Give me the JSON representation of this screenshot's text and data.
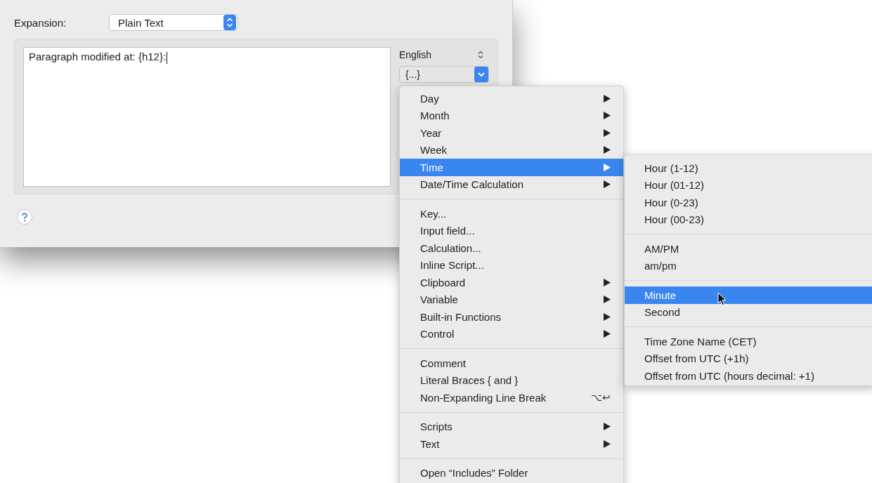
{
  "dialog": {
    "expansion_label": "Expansion:",
    "expansion_popup": {
      "value": "Plain Text"
    },
    "text_area": {
      "value": "Paragraph modified at: {h12}:"
    },
    "language_popup": {
      "value": "English"
    },
    "placeholder_popup": {
      "value": "{...}",
      "open": true
    }
  },
  "menu": {
    "groups": [
      {
        "items": [
          {
            "label": "Day",
            "submenu": true,
            "selected": false
          },
          {
            "label": "Month",
            "submenu": true,
            "selected": false
          },
          {
            "label": "Year",
            "submenu": true,
            "selected": false
          },
          {
            "label": "Week",
            "submenu": true,
            "selected": false
          },
          {
            "label": "Time",
            "submenu": true,
            "selected": true
          },
          {
            "label": "Date/Time Calculation",
            "submenu": true,
            "selected": false
          }
        ]
      },
      {
        "items": [
          {
            "label": "Key...",
            "submenu": false,
            "selected": false
          },
          {
            "label": "Input field...",
            "submenu": false,
            "selected": false
          },
          {
            "label": "Calculation...",
            "submenu": false,
            "selected": false
          },
          {
            "label": "Inline Script...",
            "submenu": false,
            "selected": false
          },
          {
            "label": "Clipboard",
            "submenu": true,
            "selected": false
          },
          {
            "label": "Variable",
            "submenu": true,
            "selected": false
          },
          {
            "label": "Built-in Functions",
            "submenu": true,
            "selected": false
          },
          {
            "label": "Control",
            "submenu": true,
            "selected": false
          }
        ]
      },
      {
        "items": [
          {
            "label": "Comment",
            "submenu": false,
            "selected": false
          },
          {
            "label": "Literal Braces { and }",
            "submenu": false,
            "selected": false
          },
          {
            "label": "Non-Expanding Line Break",
            "submenu": false,
            "selected": false,
            "shortcut": "⌥↩"
          }
        ]
      },
      {
        "items": [
          {
            "label": "Scripts",
            "submenu": true,
            "selected": false
          },
          {
            "label": "Text",
            "submenu": true,
            "selected": false
          }
        ]
      },
      {
        "items": [
          {
            "label": "Open “Includes” Folder",
            "submenu": false,
            "selected": false
          }
        ]
      }
    ]
  },
  "submenu": {
    "groups": [
      {
        "items": [
          {
            "label": "Hour (1-12)",
            "selected": false
          },
          {
            "label": "Hour (01-12)",
            "selected": false
          },
          {
            "label": "Hour (0-23)",
            "selected": false
          },
          {
            "label": "Hour (00-23)",
            "selected": false
          }
        ]
      },
      {
        "items": [
          {
            "label": "AM/PM",
            "selected": false
          },
          {
            "label": "am/pm",
            "selected": false
          }
        ]
      },
      {
        "items": [
          {
            "label": "Minute",
            "selected": true
          },
          {
            "label": "Second",
            "selected": false
          }
        ]
      },
      {
        "items": [
          {
            "label": "Time Zone Name (CET)",
            "selected": false
          },
          {
            "label": "Offset from UTC (+1h)",
            "selected": false
          },
          {
            "label": "Offset from UTC (hours decimal: +1)",
            "selected": false
          }
        ]
      }
    ]
  }
}
